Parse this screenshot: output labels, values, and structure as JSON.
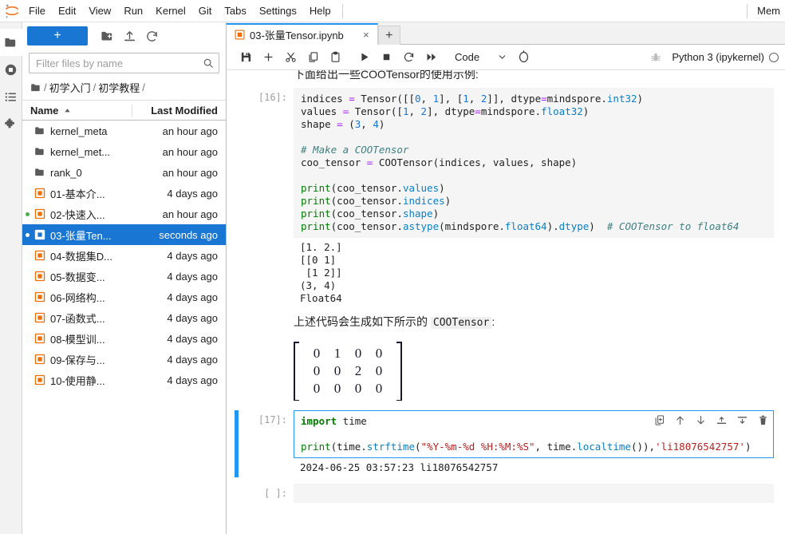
{
  "menubar": {
    "logo": "jupyter-logo",
    "items": [
      "File",
      "Edit",
      "View",
      "Run",
      "Kernel",
      "Git",
      "Tabs",
      "Settings",
      "Help"
    ],
    "right_status": "Mem"
  },
  "activitybar": {
    "items": [
      {
        "name": "file-browser",
        "icon": "folder-icon",
        "active": true
      },
      {
        "name": "running-terminals-kernels",
        "icon": "stop-circle-icon",
        "active": false
      },
      {
        "name": "table-of-contents",
        "icon": "list-icon",
        "active": false
      },
      {
        "name": "extension-manager",
        "icon": "puzzle-icon",
        "active": false
      }
    ]
  },
  "filebrowser": {
    "new_launcher_label": "+",
    "toolbar_icons": [
      "new-folder-icon",
      "upload-icon",
      "refresh-icon"
    ],
    "filter": {
      "placeholder": "Filter files by name",
      "value": ""
    },
    "breadcrumb": {
      "root_icon": "folder-icon",
      "parts": [
        "初学入门",
        "初学教程"
      ]
    },
    "columns": {
      "name": "Name",
      "last_modified": "Last Modified",
      "sort": "ascending"
    },
    "rows": [
      {
        "name": "kernel_meta",
        "modified": "an hour ago",
        "type": "folder",
        "selected": false,
        "running": false
      },
      {
        "name": "kernel_met...",
        "modified": "an hour ago",
        "type": "folder",
        "selected": false,
        "running": false
      },
      {
        "name": "rank_0",
        "modified": "an hour ago",
        "type": "folder",
        "selected": false,
        "running": false
      },
      {
        "name": "01-基本介...",
        "modified": "4 days ago",
        "type": "notebook",
        "selected": false,
        "running": false
      },
      {
        "name": "02-快速入...",
        "modified": "an hour ago",
        "type": "notebook",
        "selected": false,
        "running": true
      },
      {
        "name": "03-张量Ten...",
        "modified": "seconds ago",
        "type": "notebook",
        "selected": true,
        "running": true
      },
      {
        "name": "04-数据集D...",
        "modified": "4 days ago",
        "type": "notebook",
        "selected": false,
        "running": false
      },
      {
        "name": "05-数据变...",
        "modified": "4 days ago",
        "type": "notebook",
        "selected": false,
        "running": false
      },
      {
        "name": "06-网络构...",
        "modified": "4 days ago",
        "type": "notebook",
        "selected": false,
        "running": false
      },
      {
        "name": "07-函数式...",
        "modified": "4 days ago",
        "type": "notebook",
        "selected": false,
        "running": false
      },
      {
        "name": "08-模型训...",
        "modified": "4 days ago",
        "type": "notebook",
        "selected": false,
        "running": false
      },
      {
        "name": "09-保存与...",
        "modified": "4 days ago",
        "type": "notebook",
        "selected": false,
        "running": false
      },
      {
        "name": "10-使用静...",
        "modified": "4 days ago",
        "type": "notebook",
        "selected": false,
        "running": false
      }
    ]
  },
  "tabbar": {
    "tabs": [
      {
        "label": "03-张量Tensor.ipynb",
        "icon": "notebook-icon",
        "active": true,
        "close": "×"
      }
    ],
    "add_label": "+"
  },
  "notebook_toolbar": {
    "icons": [
      "save-icon",
      "insert-cell-icon",
      "cut-icon",
      "copy-icon",
      "paste-icon",
      "run-icon",
      "stop-icon",
      "restart-icon",
      "restart-run-all-icon"
    ],
    "cell_type": "Code",
    "cell_type_chevron": "chevron-down-icon",
    "interrupt_icon": "kernel-busy-icon",
    "debug_icon": "bug-icon",
    "kernel_name": "Python 3 (ipykernel)",
    "kernel_status_icon": "kernel-idle-circle"
  },
  "notebook": {
    "markdown_top": "下面给出一些COOTensor的使用示例:",
    "cells": [
      {
        "prompt": "[16]:",
        "selected": false,
        "code_lines": [
          "indices = Tensor([[0, 1], [1, 2]], dtype=mindspore.int32)",
          "values = Tensor([1, 2], dtype=mindspore.float32)",
          "shape = (3, 4)",
          "",
          "# Make a COOTensor",
          "coo_tensor = COOTensor(indices, values, shape)",
          "",
          "print(coo_tensor.values)",
          "print(coo_tensor.indices)",
          "print(coo_tensor.shape)",
          "print(coo_tensor.astype(mindspore.float64).dtype)  # COOTensor to float64"
        ],
        "output": "[1. 2.]\n[[0 1]\n [1 2]]\n(3, 4)\nFloat64"
      },
      {
        "prompt": "[17]:",
        "selected": true,
        "code_lines": [
          "import time",
          "",
          "print(time.strftime(\"%Y-%m-%d %H:%M:%S\", time.localtime()),'li18076542757')"
        ],
        "output": "2024-06-25 03:57:23 li18076542757",
        "cell_toolbar": [
          "duplicate-icon",
          "move-up-icon",
          "move-down-icon",
          "insert-above-icon",
          "insert-below-icon",
          "delete-icon"
        ]
      },
      {
        "prompt": "[ ]:",
        "selected": false,
        "code_lines": [
          ""
        ],
        "output": ""
      }
    ],
    "markdown_mid_prefix": "上述代码会生成如下所示的 ",
    "markdown_mid_code": "COOTensor",
    "markdown_mid_suffix": ":",
    "matrix": {
      "rows": [
        [
          "0",
          "1",
          "0",
          "0"
        ],
        [
          "0",
          "0",
          "2",
          "0"
        ],
        [
          "0",
          "0",
          "0",
          "0"
        ]
      ]
    }
  },
  "colors": {
    "accent": "#1976d2",
    "tab_active_border": "#2196f3",
    "notebook_icon": "#ef6c00",
    "selection_bg": "#1976d2",
    "running_dot": "#4caf50"
  }
}
